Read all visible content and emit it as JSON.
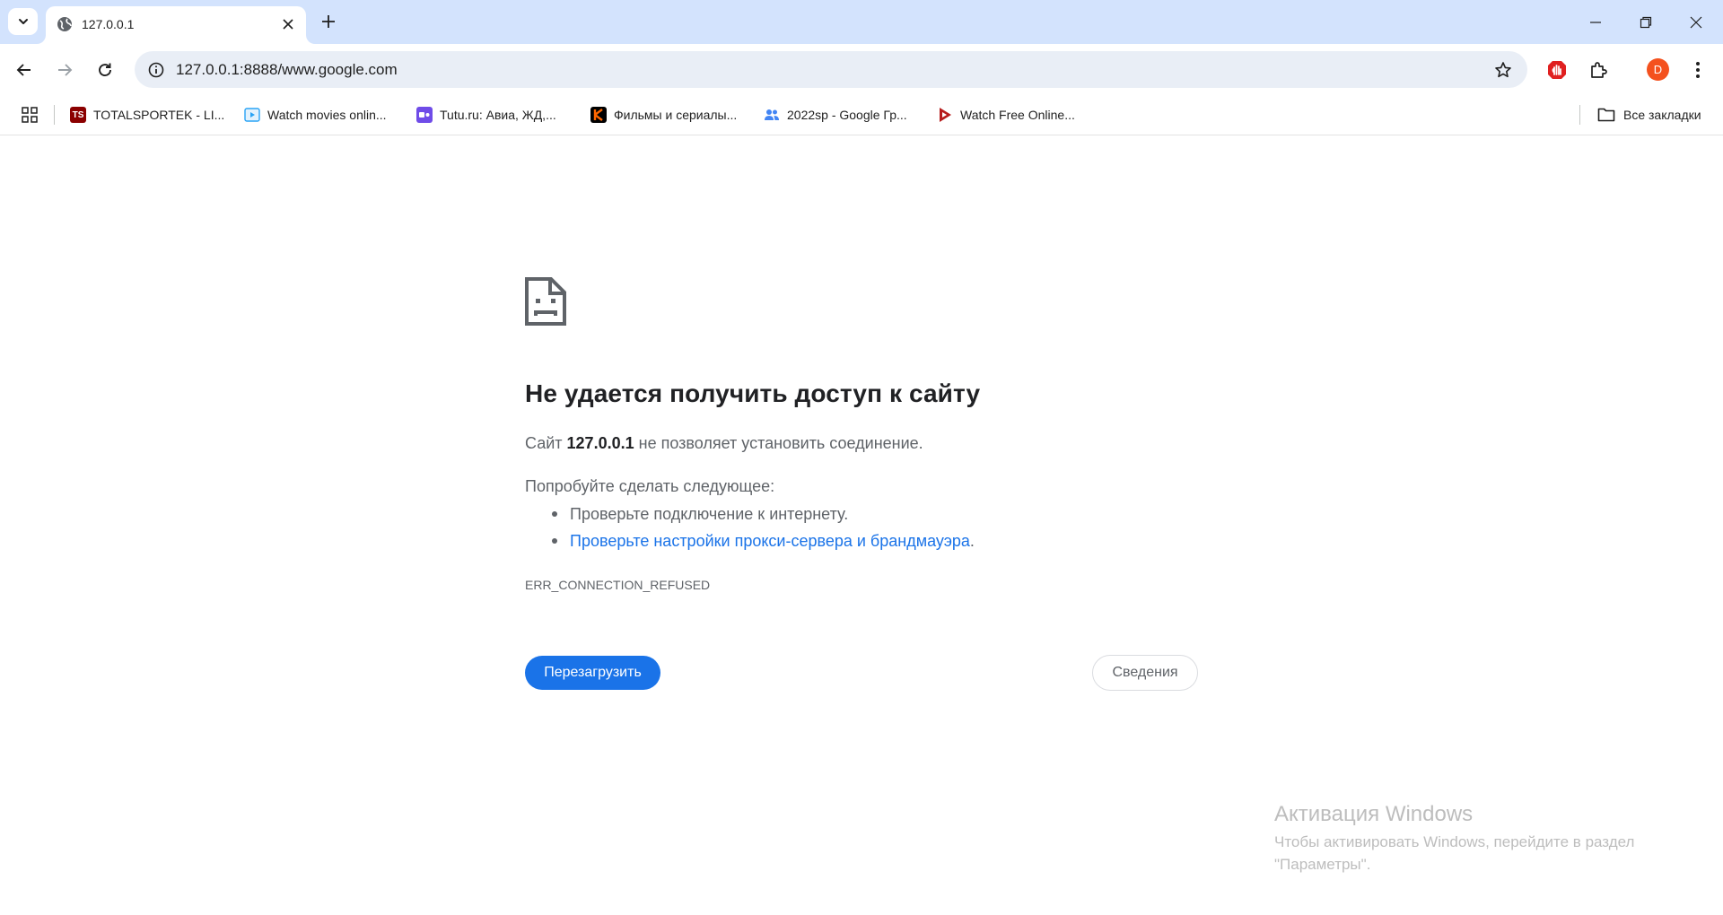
{
  "browser": {
    "tab": {
      "title": "127.0.0.1"
    },
    "address_bar": {
      "url": "127.0.0.1:8888/www.google.com"
    },
    "profile_initial": "D",
    "bookmarks": [
      {
        "label": "TOTALSPORTEK - LI...",
        "icon": "totalsportek-icon",
        "icon_text": "TS",
        "color": "#8b0000"
      },
      {
        "label": "Watch movies onlin...",
        "icon": "play-video-icon",
        "color": "#29a3f5"
      },
      {
        "label": "Tutu.ru: Авиа, ЖД,...",
        "icon": "tutu-icon",
        "color": "#6f4ce8"
      },
      {
        "label": "Фильмы и сериалы...",
        "icon": "kinopoisk-icon",
        "color": "#000000"
      },
      {
        "label": "2022sp - Google Гр...",
        "icon": "google-groups-icon",
        "color": "#4285f4"
      },
      {
        "label": "Watch Free Online...",
        "icon": "play-logo-icon",
        "color": "#b71c1c"
      }
    ],
    "all_bookmarks_label": "Все закладки"
  },
  "error_page": {
    "heading": "Не удается получить доступ к сайту",
    "line_prefix": "Сайт",
    "host": "127.0.0.1",
    "line_suffix": "не позволяет установить соединение.",
    "try_heading": "Попробуйте сделать следующее:",
    "suggestions": [
      "Проверьте подключение к интернету.",
      "Проверьте настройки прокси-сервера и брандмауэра"
    ],
    "suggestion_link_trailer": ".",
    "error_code": "ERR_CONNECTION_REFUSED",
    "reload_label": "Перезагрузить",
    "details_label": "Сведения"
  },
  "windows_watermark": {
    "title": "Активация Windows",
    "text": "Чтобы активировать Windows, перейдите в раздел \"Параметры\"."
  },
  "colors": {
    "tabstrip": "#d3e3fd",
    "omnibox": "#e9eef6",
    "accent": "#1a73e8",
    "avatar": "#f4511e"
  }
}
